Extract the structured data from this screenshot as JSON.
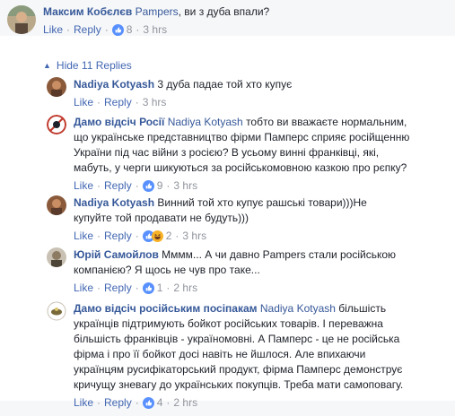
{
  "top_comment": {
    "author": "Максим Кобєлєв",
    "tag": "Pampers",
    "text": ", ви з дуба впали?",
    "like": "Like",
    "reply": "Reply",
    "reactions": "8",
    "time": "3 hrs"
  },
  "hide_replies": "Hide 11 Replies",
  "replies": [
    {
      "author": "Nadiya Kotyash",
      "text_lines": [
        "3 дуба падае той хто купує"
      ],
      "like": "Like",
      "reply": "Reply",
      "time": "3 hrs"
    },
    {
      "author": "Дамо відсіч Росії",
      "tag": "Nadiya Kotyash",
      "text_lines": [
        " тобто ви вважаєте нормальним,",
        "що українське представництво фірми Памперс сприяє російщенню",
        "України під час війни з росією? В усьому винні франківці, які,",
        "мабуть, у черги шикуються за російськомовною казкою про рєпку?"
      ],
      "like": "Like",
      "reply": "Reply",
      "reactions": "9",
      "time": "3 hrs"
    },
    {
      "author": "Nadiya Kotyash",
      "text_lines": [
        " Винний той хто купує рашські товари)))Не",
        "купуйте той продавати не будуть)))"
      ],
      "like": "Like",
      "reply": "Reply",
      "reactions": "2",
      "time": "3 hrs"
    },
    {
      "author": "Юрій Самойлов",
      "text_lines": [
        " Мммм... А чи давно Pampers стали російською",
        "компанією? Я щось не чув про таке..."
      ],
      "like": "Like",
      "reply": "Reply",
      "reactions": "1",
      "time": "2 hrs"
    },
    {
      "author": "Дамо відсіч російським посіпакам",
      "tag": "Nadiya Kotyash",
      "text_lines": [
        " більшість",
        "українців підтримують бойкот російських товарів. І переважна",
        "більшість франківців - україномовні. А Памперс - це не російська",
        "фірма і про її бойкот досі навіть не йшлося. Але впихаючи",
        "українцям русифікаторський продукт, фірма Памперс демонструє",
        "кричущу зневагу до українських покупців. Треба мати самоповагу."
      ],
      "like": "Like",
      "reply": "Reply",
      "reactions": "4",
      "time": "2 hrs"
    }
  ],
  "colors": {
    "link": "#365899",
    "action": "#4267b2",
    "meta": "#90949c",
    "like_blue": "#5890ff",
    "haha_yellow": "#f7b125"
  }
}
